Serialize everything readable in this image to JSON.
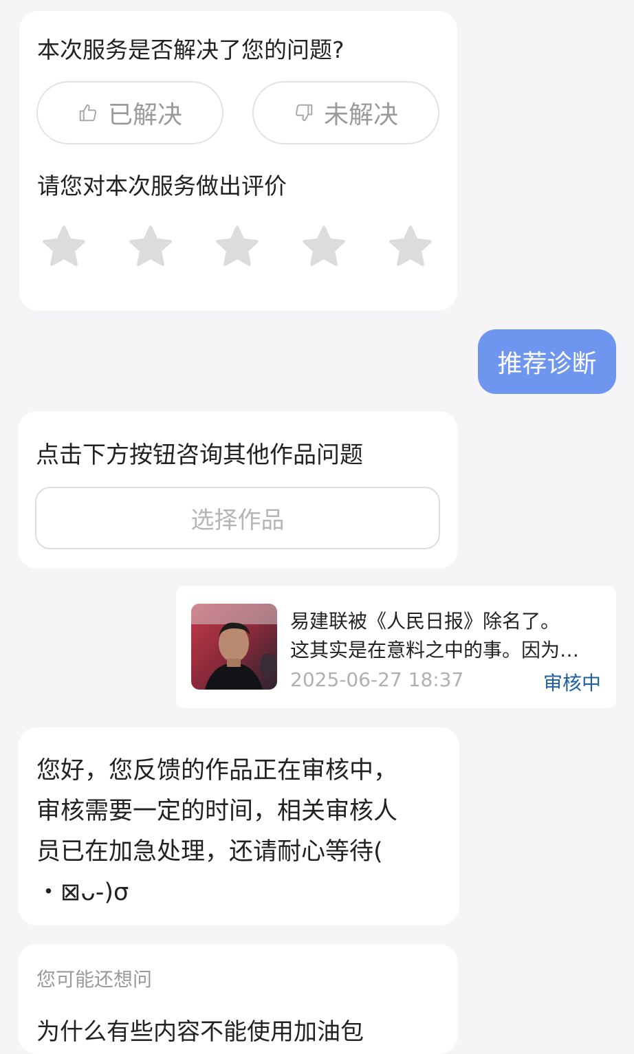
{
  "feedback": {
    "question": "本次服务是否解决了您的问题?",
    "resolved_label": "已解决",
    "unresolved_label": "未解决",
    "rating_prompt": "请您对本次服务做出评价",
    "stars_total": 5,
    "stars_selected": 0,
    "star_color": "#dcdcdc"
  },
  "user_bubble": {
    "text": "推荐诊断",
    "color": "#6f96ee"
  },
  "select_card": {
    "prompt": "点击下方按钮咨询其他作品问题",
    "button_label": "选择作品"
  },
  "work_card": {
    "title_line1": "易建联被《人民日报》除名了。",
    "title_line2": "这其实是在意料之中的事。因为…",
    "time": "2025-06-27 18:37",
    "status": "审核中",
    "status_color": "#1f5fa0"
  },
  "reply": {
    "line1": "您好，您反馈的作品正在审核中，",
    "line2": "审核需要一定的时间，相关审核人",
    "line3": "员已在加急处理，还请耐心等待(",
    "line4": "・⊠ᴗ-)σ"
  },
  "suggestions": {
    "title": "您可能还想问",
    "items": [
      "为什么有些内容不能使用加油包"
    ]
  }
}
